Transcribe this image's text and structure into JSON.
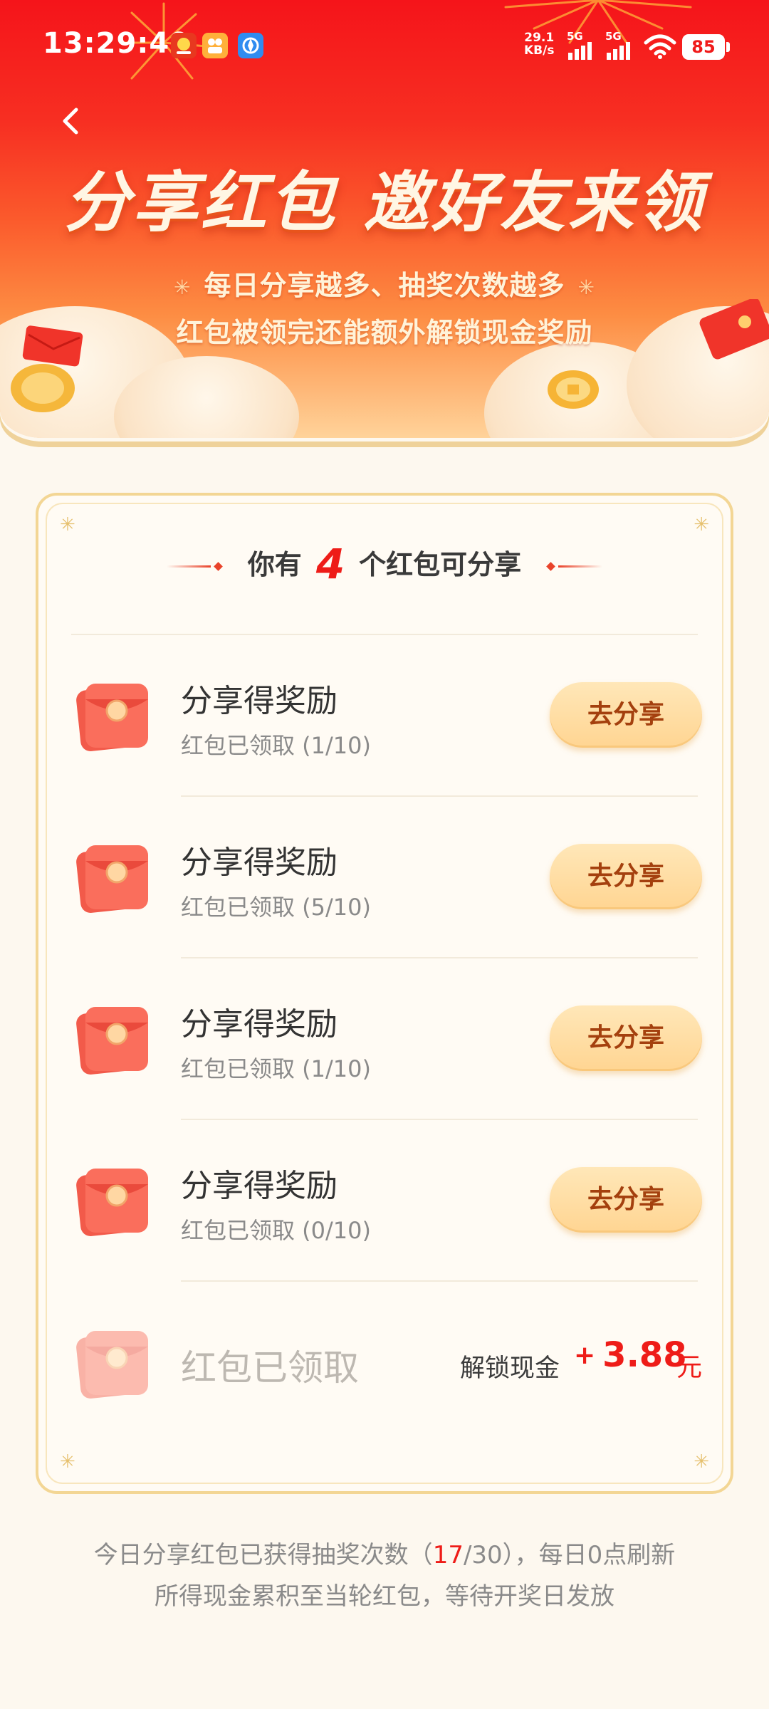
{
  "status_bar": {
    "time": "13:29:49",
    "net_speed_value": "29.1",
    "net_speed_unit": "KB/s",
    "signal1_label": "5G",
    "signal2_label": "5G",
    "battery": "85",
    "icons": [
      "app-notification-icon",
      "photo-app-icon",
      "browser-app-icon",
      "signal-icon",
      "signal-icon",
      "wifi-icon",
      "battery-icon"
    ]
  },
  "header": {
    "back_icon": "chevron-left-icon",
    "title": "分享红包 邀好友来领",
    "subtitle_line1": "每日分享越多、抽奖次数越多",
    "subtitle_line2": "红包被领完还能额外解锁现金奖励"
  },
  "card": {
    "heading_prefix": "你有",
    "heading_count": "4",
    "heading_suffix": "个红包可分享",
    "items": [
      {
        "title": "分享得奖励",
        "status": "红包已领取 (1/10)",
        "button": "去分享"
      },
      {
        "title": "分享得奖励",
        "status": "红包已领取 (5/10)",
        "button": "去分享"
      },
      {
        "title": "分享得奖励",
        "status": "红包已领取 (1/10)",
        "button": "去分享"
      },
      {
        "title": "分享得奖励",
        "status": "红包已领取 (0/10)",
        "button": "去分享"
      }
    ],
    "claimed": {
      "title": "红包已领取",
      "unlock_label": "解锁现金",
      "plus": "+",
      "amount": "3.88",
      "unit": "元"
    }
  },
  "footer": {
    "line1_prefix": "今日分享红包已获得抽奖次数（",
    "line1_current": "17",
    "line1_total": "/30）",
    "line1_suffix": "，每日0点刷新",
    "line2": "所得现金累积至当轮红包，等待开奖日发放"
  },
  "colors": {
    "accent_red": "#ee1c18",
    "banner_top": "#f5141a",
    "button_bg": "#ffd592",
    "button_text": "#a4400e",
    "page_bg": "#fdf8ef"
  }
}
